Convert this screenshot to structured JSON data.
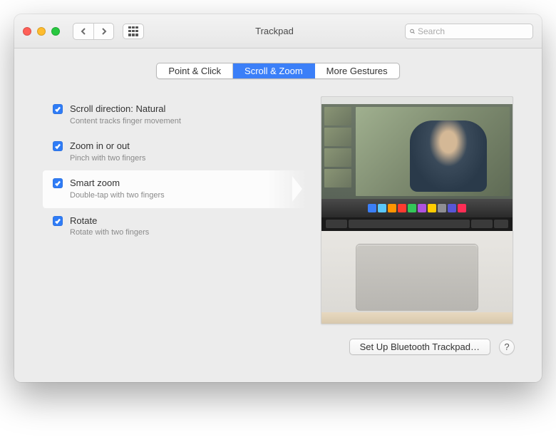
{
  "window": {
    "title": "Trackpad"
  },
  "search": {
    "placeholder": "Search"
  },
  "tabs": [
    {
      "label": "Point & Click",
      "active": false
    },
    {
      "label": "Scroll & Zoom",
      "active": true
    },
    {
      "label": "More Gestures",
      "active": false
    }
  ],
  "options": [
    {
      "label": "Scroll direction: Natural",
      "desc": "Content tracks finger movement",
      "checked": true,
      "selected": false
    },
    {
      "label": "Zoom in or out",
      "desc": "Pinch with two fingers",
      "checked": true,
      "selected": false
    },
    {
      "label": "Smart zoom",
      "desc": "Double-tap with two fingers",
      "checked": true,
      "selected": true
    },
    {
      "label": "Rotate",
      "desc": "Rotate with two fingers",
      "checked": true,
      "selected": false
    }
  ],
  "footer": {
    "setup_button": "Set Up Bluetooth Trackpad…",
    "help_label": "?"
  }
}
